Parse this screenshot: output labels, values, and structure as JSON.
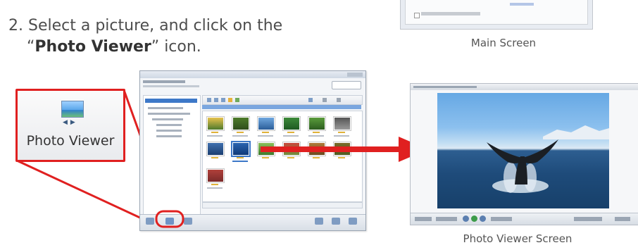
{
  "instruction": {
    "line1": "2. Select a picture, and click on the",
    "line2_prefix": "“",
    "line2_bold": "Photo Viewer",
    "line2_suffix": "” icon."
  },
  "captions": {
    "main_screen": "Main Screen",
    "photo_viewer_screen": "Photo Viewer Screen"
  },
  "photo_viewer_button": {
    "label": "Photo Viewer",
    "icon": "photo-viewer-icon"
  },
  "colors": {
    "highlight_red": "#e02020",
    "text_gray": "#4d4d4d",
    "selection_blue": "#3d78c8"
  }
}
